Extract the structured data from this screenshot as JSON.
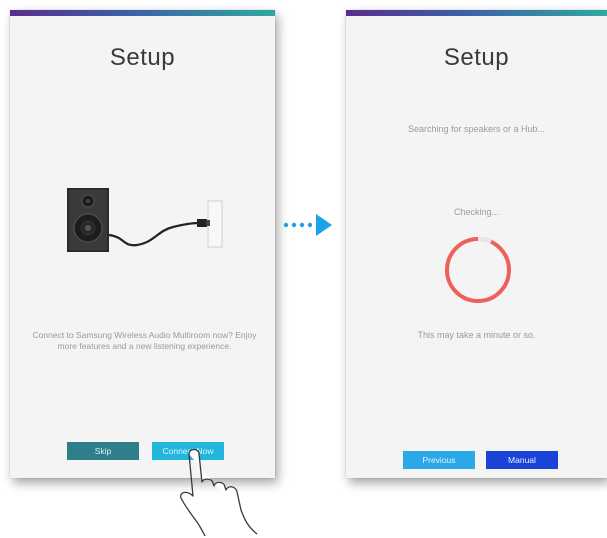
{
  "left_screen": {
    "title": "Setup",
    "message": "Connect to Samsung Wireless Audio Multiroom now? Enjoy more features and a new listening experience.",
    "buttons": {
      "skip": "Skip",
      "connect_now": "Connect Now"
    }
  },
  "right_screen": {
    "title": "Setup",
    "searching": "Searching for speakers or a Hub...",
    "checking": "Checking...",
    "wait_note": "This may take a minute or so.",
    "buttons": {
      "previous": "Previous",
      "manual": "Manual"
    }
  },
  "colors": {
    "topbar_start": "#5a2d8c",
    "topbar_end": "#2fa8a0",
    "skip_button": "#2e7f8a",
    "connect_button": "#21b6da",
    "previous_button": "#2aa9e6",
    "manual_button": "#1b43d8",
    "spinner": "#f0605a",
    "arrow": "#1aa3e6"
  },
  "icons": [
    "speaker-icon",
    "power-cable-icon",
    "wall-outlet-icon",
    "loading-ring-icon",
    "transition-arrow-icon",
    "tap-hand-icon"
  ]
}
